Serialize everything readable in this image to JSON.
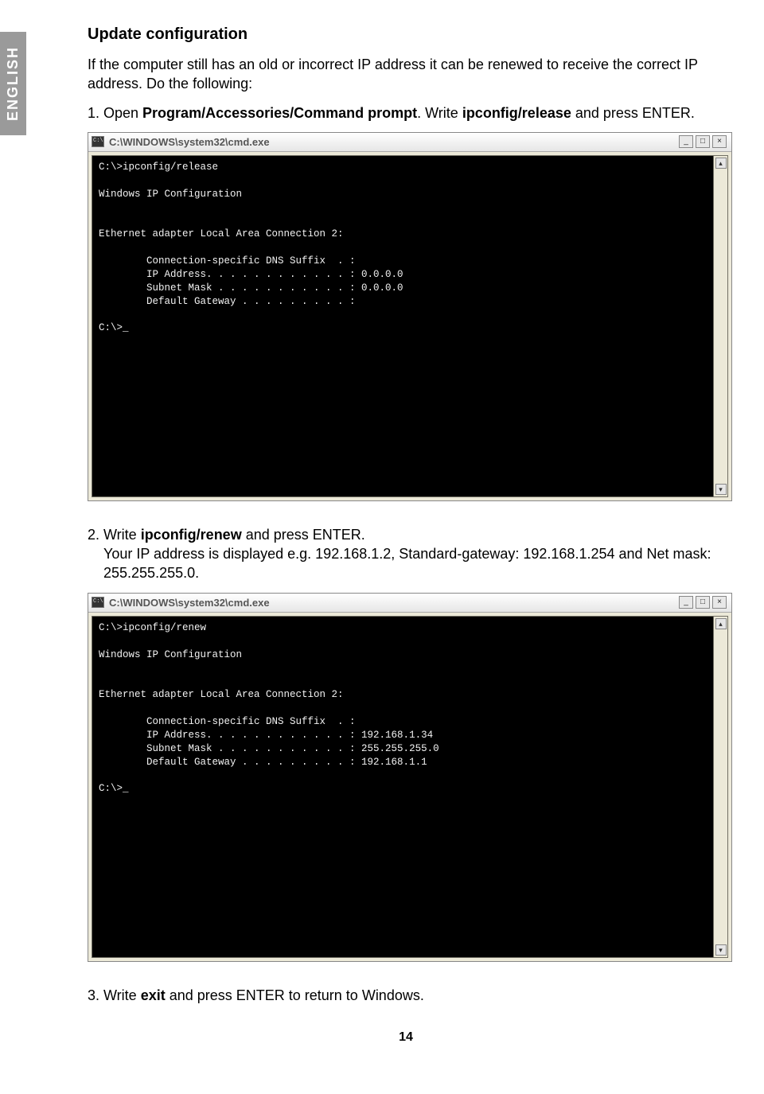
{
  "lang_tab": "ENGLISH",
  "heading": "Update configuration",
  "intro1": "If the computer still has an old or incorrect IP address it can be renewed to receive the correct IP address. Do the following:",
  "step1_pre": "1.  Open ",
  "step1_bold": "Program/Accessories/Command prompt",
  "step1_mid": ".  Write ",
  "step1_bold2": "ipconfig/release",
  "step1_post": " and press ENTER.",
  "cmd1_title": "C:\\WINDOWS\\system32\\cmd.exe",
  "cmd1_body": "C:\\>ipconfig/release\n\nWindows IP Configuration\n\n\nEthernet adapter Local Area Connection 2:\n\n        Connection-specific DNS Suffix  . :\n        IP Address. . . . . . . . . . . . : 0.0.0.0\n        Subnet Mask . . . . . . . . . . . : 0.0.0.0\n        Default Gateway . . . . . . . . . :\n\nC:\\>_",
  "step2_pre": "2.  Write ",
  "step2_bold": "ipconfig/renew",
  "step2_post": " and press ENTER.",
  "step2_line2a": "Your IP address is displayed e.g. ",
  "step2_ip": "192.168.1.2",
  "step2_line2b": ", Standard-gateway: ",
  "step2_gw": "192.168.1.254",
  "step2_line2c": " and Net mask:  ",
  "step2_mask": "255.255.255.0.",
  "cmd2_title": "C:\\WINDOWS\\system32\\cmd.exe",
  "cmd2_body": "C:\\>ipconfig/renew\n\nWindows IP Configuration\n\n\nEthernet adapter Local Area Connection 2:\n\n        Connection-specific DNS Suffix  . :\n        IP Address. . . . . . . . . . . . : 192.168.1.34\n        Subnet Mask . . . . . . . . . . . : 255.255.255.0\n        Default Gateway . . . . . . . . . : 192.168.1.1\n\nC:\\>_",
  "step3_pre": "3.  Write ",
  "step3_bold": "exit",
  "step3_post": " and press ENTER to return to Windows.",
  "page_number": "14",
  "win_min": "_",
  "win_max": "□",
  "win_close": "×",
  "arrow_up": "▴",
  "arrow_down": "▾"
}
